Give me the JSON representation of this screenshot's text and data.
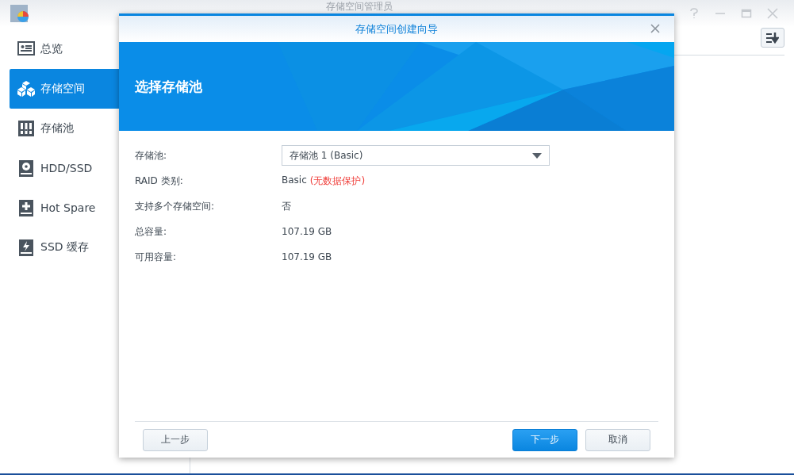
{
  "window": {
    "title": "存储空间管理员"
  },
  "sidebar": {
    "items": [
      {
        "label": "总览",
        "kind": "overview",
        "selected": false
      },
      {
        "label": "存储空间",
        "kind": "volume",
        "selected": true
      },
      {
        "label": "存储池",
        "kind": "pool",
        "selected": false
      },
      {
        "label": "HDD/SSD",
        "kind": "disk",
        "selected": false
      },
      {
        "label": "Hot Spare",
        "kind": "spare",
        "selected": false
      },
      {
        "label": "SSD 缓存",
        "kind": "cache",
        "selected": false
      }
    ]
  },
  "dialog": {
    "title": "存储空间创建向导",
    "heading": "选择存储池",
    "fields": [
      {
        "label": "存储池:",
        "kind": "select",
        "value": "存储池 1 (Basic)"
      },
      {
        "label": "RAID 类别:",
        "kind": "text",
        "value": "Basic",
        "note": "(无数据保护)"
      },
      {
        "label": "支持多个存储空间:",
        "kind": "text",
        "value": "否"
      },
      {
        "label": "总容量:",
        "kind": "text",
        "value": "107.19 GB"
      },
      {
        "label": "可用容量:",
        "kind": "text",
        "value": "107.19 GB"
      }
    ],
    "buttons": [
      {
        "label": "上一步",
        "kind": "back"
      },
      {
        "label": "下一步",
        "kind": "primary"
      },
      {
        "label": "取消",
        "kind": "normal"
      }
    ]
  }
}
